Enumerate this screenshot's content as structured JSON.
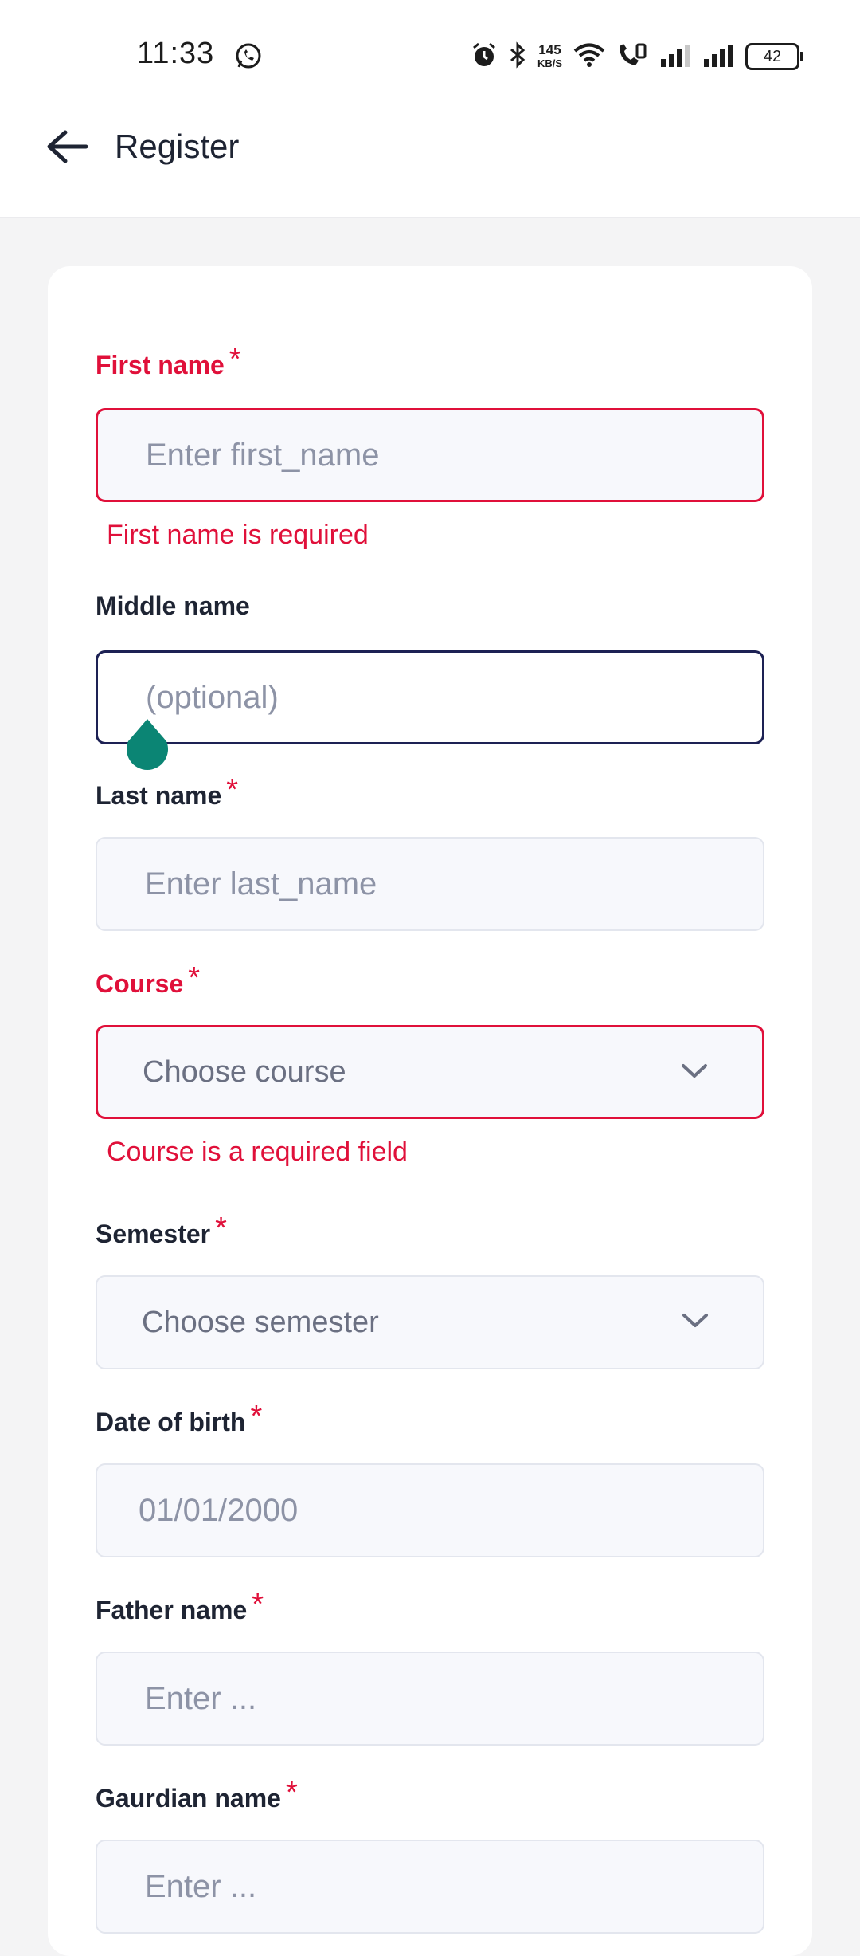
{
  "status_bar": {
    "time": "11:33",
    "speed_value": "145",
    "speed_unit": "KB/S",
    "battery": "42"
  },
  "app_bar": {
    "title": "Register"
  },
  "form": {
    "first_name": {
      "label": "First name",
      "required_mark": "*",
      "placeholder": "Enter first_name",
      "error": "First name is required"
    },
    "middle_name": {
      "label": "Middle name",
      "placeholder": "(optional)"
    },
    "last_name": {
      "label": "Last name",
      "required_mark": "*",
      "placeholder": "Enter last_name"
    },
    "course": {
      "label": "Course",
      "required_mark": "*",
      "placeholder": "Choose course",
      "error": "Course is a required field"
    },
    "semester": {
      "label": "Semester",
      "required_mark": "*",
      "placeholder": "Choose semester"
    },
    "dob": {
      "label": "Date of birth",
      "required_mark": "*",
      "placeholder": "01/01/2000"
    },
    "father_name": {
      "label": "Father name",
      "required_mark": "*",
      "placeholder": "Enter ..."
    },
    "guardian_name": {
      "label": "Gaurdian name",
      "required_mark": "*",
      "placeholder": "Enter ..."
    }
  },
  "colors": {
    "error": "#e0103a",
    "focus_border": "#1d2154",
    "text_handle": "#0b8574"
  }
}
